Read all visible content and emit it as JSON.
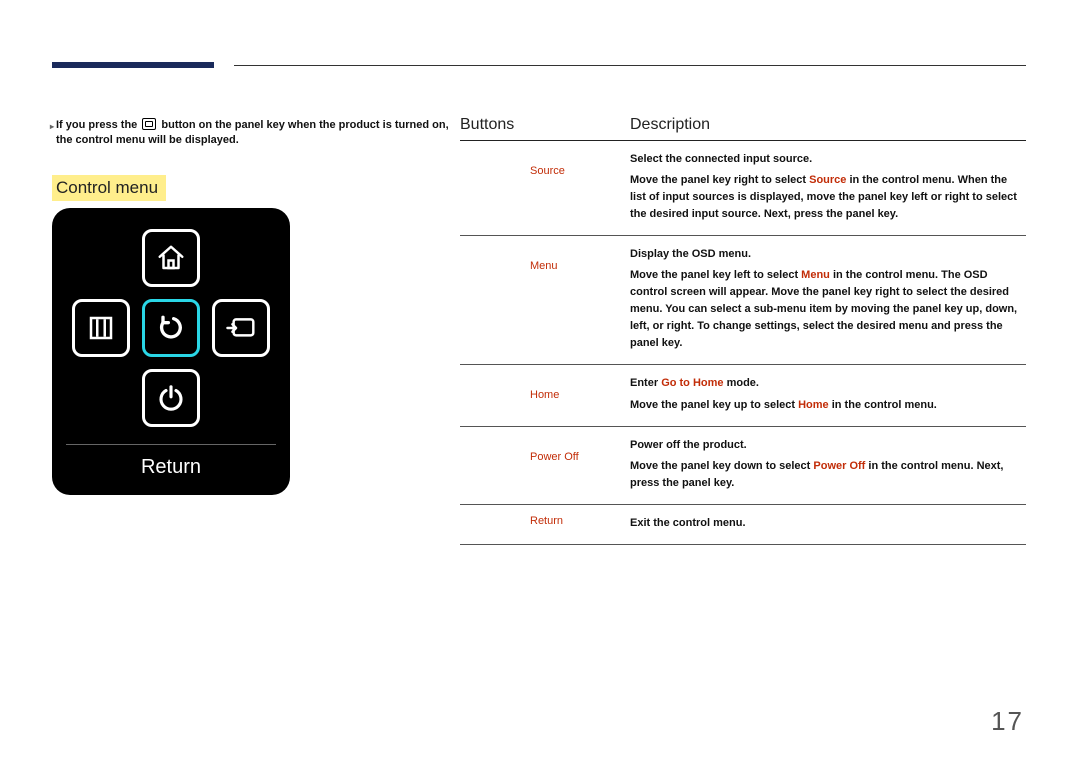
{
  "note": {
    "before": "If you press the",
    "after": " button on the panel key when the product is turned on, the control menu will be displayed."
  },
  "section_heading": "Control menu",
  "panel": {
    "bottom_label": "Return"
  },
  "columns": {
    "buttons": "Buttons",
    "description": "Description"
  },
  "rows": {
    "source": {
      "name": "Source",
      "lead": "Select the connected input source.",
      "d1a": "Move the panel key right to select ",
      "kw": "Source",
      "d1b": " in the control menu. When the list of input sources is displayed, move the panel key left or right to select the desired input source. Next, press the panel key."
    },
    "menu": {
      "name": "Menu",
      "lead": "Display the OSD menu.",
      "d1a": "Move the panel key left to select ",
      "kw": "Menu",
      "d1b": " in the control menu. The OSD control screen will appear. Move the panel key right to select the desired menu. You can select a sub-menu item by moving the panel key up, down, left, or right. To change settings, select the desired menu and press the panel key."
    },
    "home": {
      "name": "Home",
      "lead_a": "Enter ",
      "lead_kw": "Go to Home",
      "lead_b": " mode.",
      "d1a": "Move the panel key up to select ",
      "kw": "Home",
      "d1b": " in the control menu."
    },
    "power": {
      "name": "Power Off",
      "lead": "Power off the product.",
      "d1a": "Move the panel key down to select ",
      "kw": "Power Off",
      "d1b": " in the control menu. Next, press the panel key."
    },
    "return": {
      "name": "Return",
      "lead": "Exit the control menu."
    }
  },
  "page_number": "17"
}
